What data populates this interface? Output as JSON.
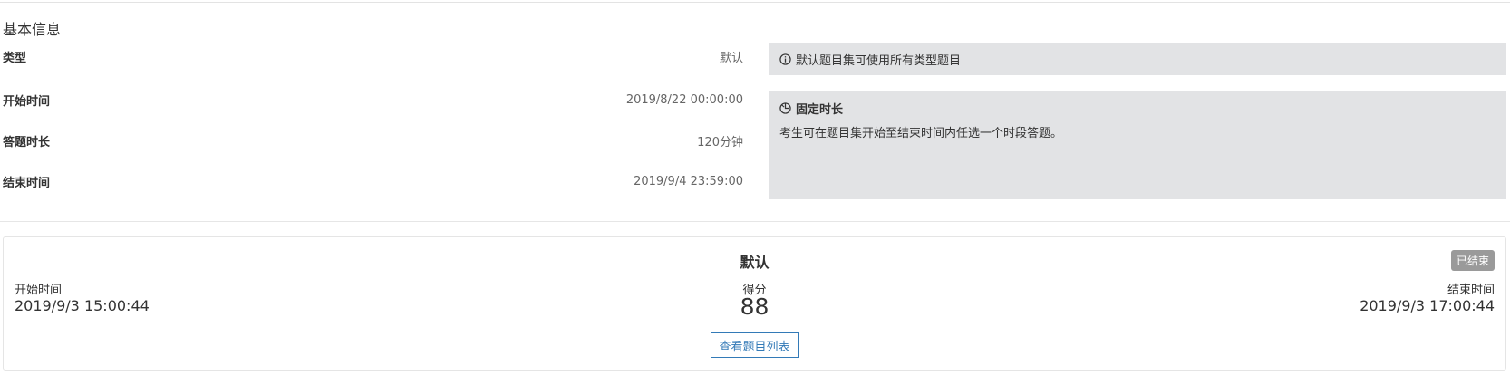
{
  "section": {
    "title": "基本信息"
  },
  "info": {
    "type_label": "类型",
    "type_value": "默认",
    "start_label": "开始时间",
    "start_value": "2019/8/22 00:00:00",
    "duration_label": "答题时长",
    "duration_value": "120分钟",
    "end_label": "结束时间",
    "end_value": "2019/9/4 23:59:00"
  },
  "notes": {
    "type_note": "默认题目集可使用所有类型题目",
    "duration_heading": "固定时长",
    "duration_text": "考生可在题目集开始至结束时间内任选一个时段答题。"
  },
  "record": {
    "title": "默认",
    "status": "已结束",
    "start_label": "开始时间",
    "start_value": "2019/9/3 15:00:44",
    "score_label": "得分",
    "score_value": "88",
    "end_label": "结束时间",
    "end_value": "2019/9/3 17:00:44",
    "button_label": "查看题目列表"
  },
  "icons": {
    "info": "info-circle-icon",
    "duration": "timer-icon"
  },
  "colors": {
    "note_background": "#e2e3e5",
    "badge_background": "#9a9a9a",
    "button_accent": "#337ab7"
  }
}
